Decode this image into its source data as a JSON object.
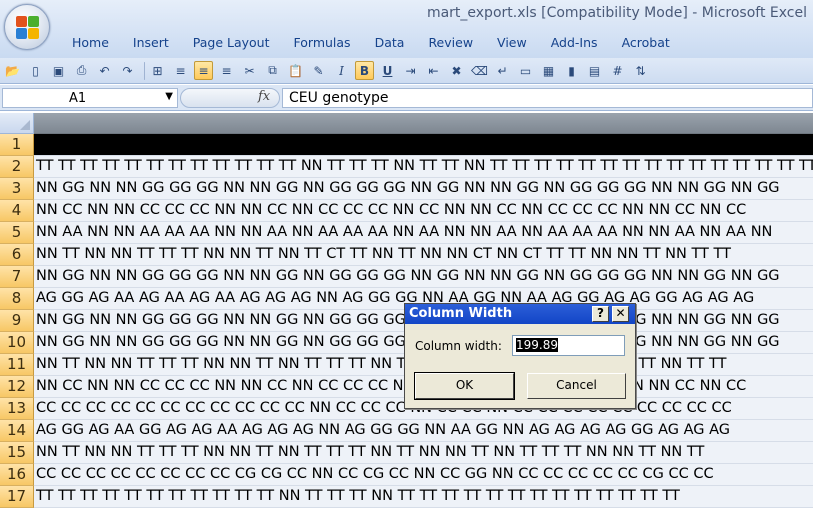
{
  "window": {
    "title": "mart_export.xls  [Compatibility Mode]  -  Microsoft Excel"
  },
  "ribbon": {
    "tabs": [
      "Home",
      "Insert",
      "Page Layout",
      "Formulas",
      "Data",
      "Review",
      "View",
      "Add-Ins",
      "Acrobat"
    ]
  },
  "toolbar": {
    "icons": [
      "open-icon",
      "new-icon",
      "save-icon",
      "print-preview-icon",
      "undo-icon",
      "redo-icon",
      "borders-icon",
      "align-left-icon",
      "align-center-icon",
      "align-right-icon",
      "cut-icon",
      "copy-icon",
      "paste-icon",
      "format-painter-icon",
      "italic-icon",
      "bold-icon",
      "underline-icon",
      "indent-icon",
      "outdent-icon",
      "delete-cells-icon",
      "clear-icon",
      "wrap-icon",
      "merge-icon",
      "table-icon",
      "chart-icon",
      "grid-icon",
      "insert-icon",
      "sort-icon"
    ]
  },
  "formula_bar": {
    "name_box": "A1",
    "fx": "fx",
    "content": "CEU genotype"
  },
  "grid": {
    "rows": [
      {
        "num": "1",
        "text": ""
      },
      {
        "num": "2",
        "text": "TT TT TT TT TT TT TT TT TT TT TT TT NN TT TT TT NN TT TT NN TT TT TT TT TT TT TT TT TT TT TT TT TT TT TT TT TT"
      },
      {
        "num": "3",
        "text": "NN GG NN NN GG GG GG NN NN GG NN GG GG GG NN GG NN NN GG NN GG GG GG NN NN GG NN GG"
      },
      {
        "num": "4",
        "text": "NN CC NN NN CC CC CC NN NN CC NN CC CC CC NN CC NN NN CC NN CC CC CC NN NN CC NN CC"
      },
      {
        "num": "5",
        "text": "NN AA NN NN AA AA AA NN NN AA NN AA AA AA NN AA NN NN AA NN AA AA AA NN NN AA NN AA NN"
      },
      {
        "num": "6",
        "text": "NN TT NN NN TT TT TT NN NN TT NN TT CT TT NN TT NN NN CT NN CT TT TT NN NN TT NN TT TT"
      },
      {
        "num": "7",
        "text": "NN GG NN NN GG GG GG NN NN GG NN GG GG GG NN GG NN NN GG NN GG GG GG NN NN GG NN GG"
      },
      {
        "num": "8",
        "text": "AG GG AG AA AG AA AG AA AG AG AG NN AG GG GG NN AA GG NN AA AG GG AG AG GG AG AG AG"
      },
      {
        "num": "9",
        "text": "NN GG NN NN GG GG GG NN NN GG NN GG GG GG NN GG NN NN GG NN GG GG GG NN NN GG NN GG"
      },
      {
        "num": "10",
        "text": "NN GG NN NN GG GG GG NN NN GG NN GG GG GG NN GG NN NN GG NN GG GG GG NN NN GG NN GG"
      },
      {
        "num": "11",
        "text": "NN TT NN NN TT TT TT NN NN TT NN TT TT TT NN TT NN NN TT NN TT TT TT NN NN TT NN TT TT"
      },
      {
        "num": "12",
        "text": "NN CC NN NN CC CC CC NN NN CC NN CC CC CC NN CC NN NN CC NN CC CC CC NN NN CC NN CC"
      },
      {
        "num": "13",
        "text": "CC CC CC CC CC CC CC CC CC CC CC NN CC CC CC NN CC CC NN CC CC CC CC CC CC CC CC CC"
      },
      {
        "num": "14",
        "text": "AG GG AG AA GG AG AG AA AG AG AG NN AG GG GG NN AA GG NN AG AG AG AG GG AG AG AG"
      },
      {
        "num": "15",
        "text": "NN TT NN NN TT TT TT NN NN TT NN TT TT TT NN TT NN NN TT NN TT TT TT NN NN TT NN TT"
      },
      {
        "num": "16",
        "text": "CC CC CC CC CC CC CC CC CG CG CC NN CC CG CC NN CC GG NN CC CC CC CC CC CG CC CC"
      },
      {
        "num": "17",
        "text": "TT TT TT TT TT TT TT TT TT TT TT NN TT TT TT NN TT TT TT TT TT TT TT TT TT TT TT TT TT"
      }
    ]
  },
  "dialog": {
    "title": "Column Width",
    "help": "?",
    "close": "✕",
    "label": "Column width:",
    "value": "199.89",
    "ok": "OK",
    "cancel": "Cancel"
  }
}
